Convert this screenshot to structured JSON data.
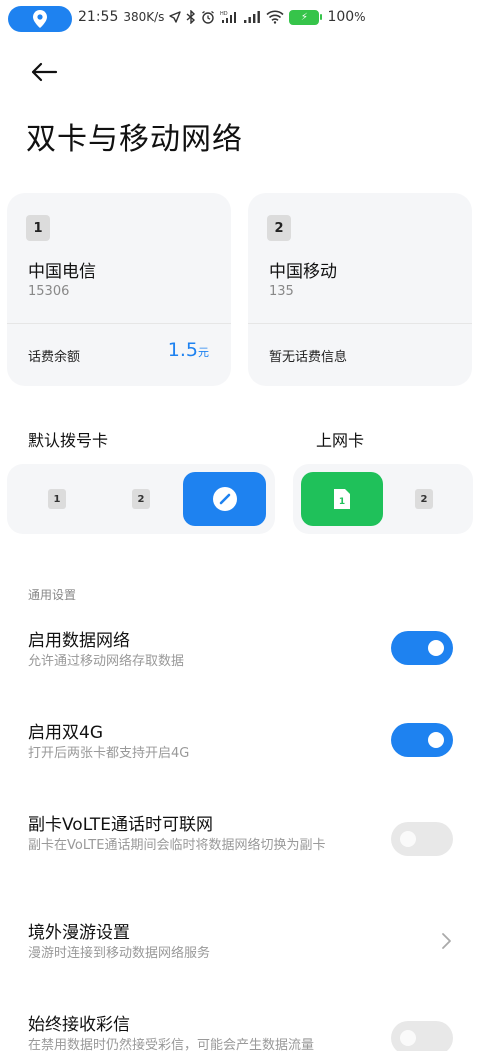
{
  "status_bar": {
    "time": "21:55",
    "speed": "380K/s",
    "battery": "100",
    "battery_unit": "%",
    "icons": [
      "location-icon",
      "navigation-icon",
      "bluetooth-icon",
      "alarm-icon",
      "hd-signal-icon",
      "signal-icon",
      "wifi-icon",
      "battery-icon"
    ]
  },
  "page": {
    "title": "双卡与移动网络"
  },
  "sim_cards": [
    {
      "slot": "1",
      "carrier": "中国电信",
      "number": "15306",
      "balance_label": "话费余额",
      "balance_value": "1.5",
      "balance_unit": "元"
    },
    {
      "slot": "2",
      "carrier": "中国移动",
      "number": "135",
      "balance_label": "暂无话费信息"
    }
  ],
  "default_dial": {
    "label": "默认拨号卡",
    "options": [
      "1",
      "2"
    ],
    "selected": "auto"
  },
  "data_sim": {
    "label": "上网卡",
    "options": [
      "1",
      "2"
    ],
    "selected": "1"
  },
  "general": {
    "header": "通用设置",
    "rows": [
      {
        "title": "启用数据网络",
        "subtitle": "允许通过移动网络存取数据",
        "toggle": true
      },
      {
        "title": "启用双4G",
        "subtitle": "打开后两张卡都支持开启4G",
        "toggle": true
      },
      {
        "title": "副卡VoLTE通话时可联网",
        "subtitle": "副卡在VoLTE通话期间会临时将数据网络切换为副卡",
        "toggle": false
      },
      {
        "title": "境外漫游设置",
        "subtitle": "漫游时连接到移动数据网络服务",
        "chevron": true
      },
      {
        "title": "始终接收彩信",
        "subtitle": "在禁用数据时仍然接受彩信，可能会产生数据流量",
        "toggle": false
      }
    ]
  },
  "colors": {
    "accent": "#1e82f0",
    "green": "#1fc15a",
    "card_bg": "#f5f6f8"
  }
}
